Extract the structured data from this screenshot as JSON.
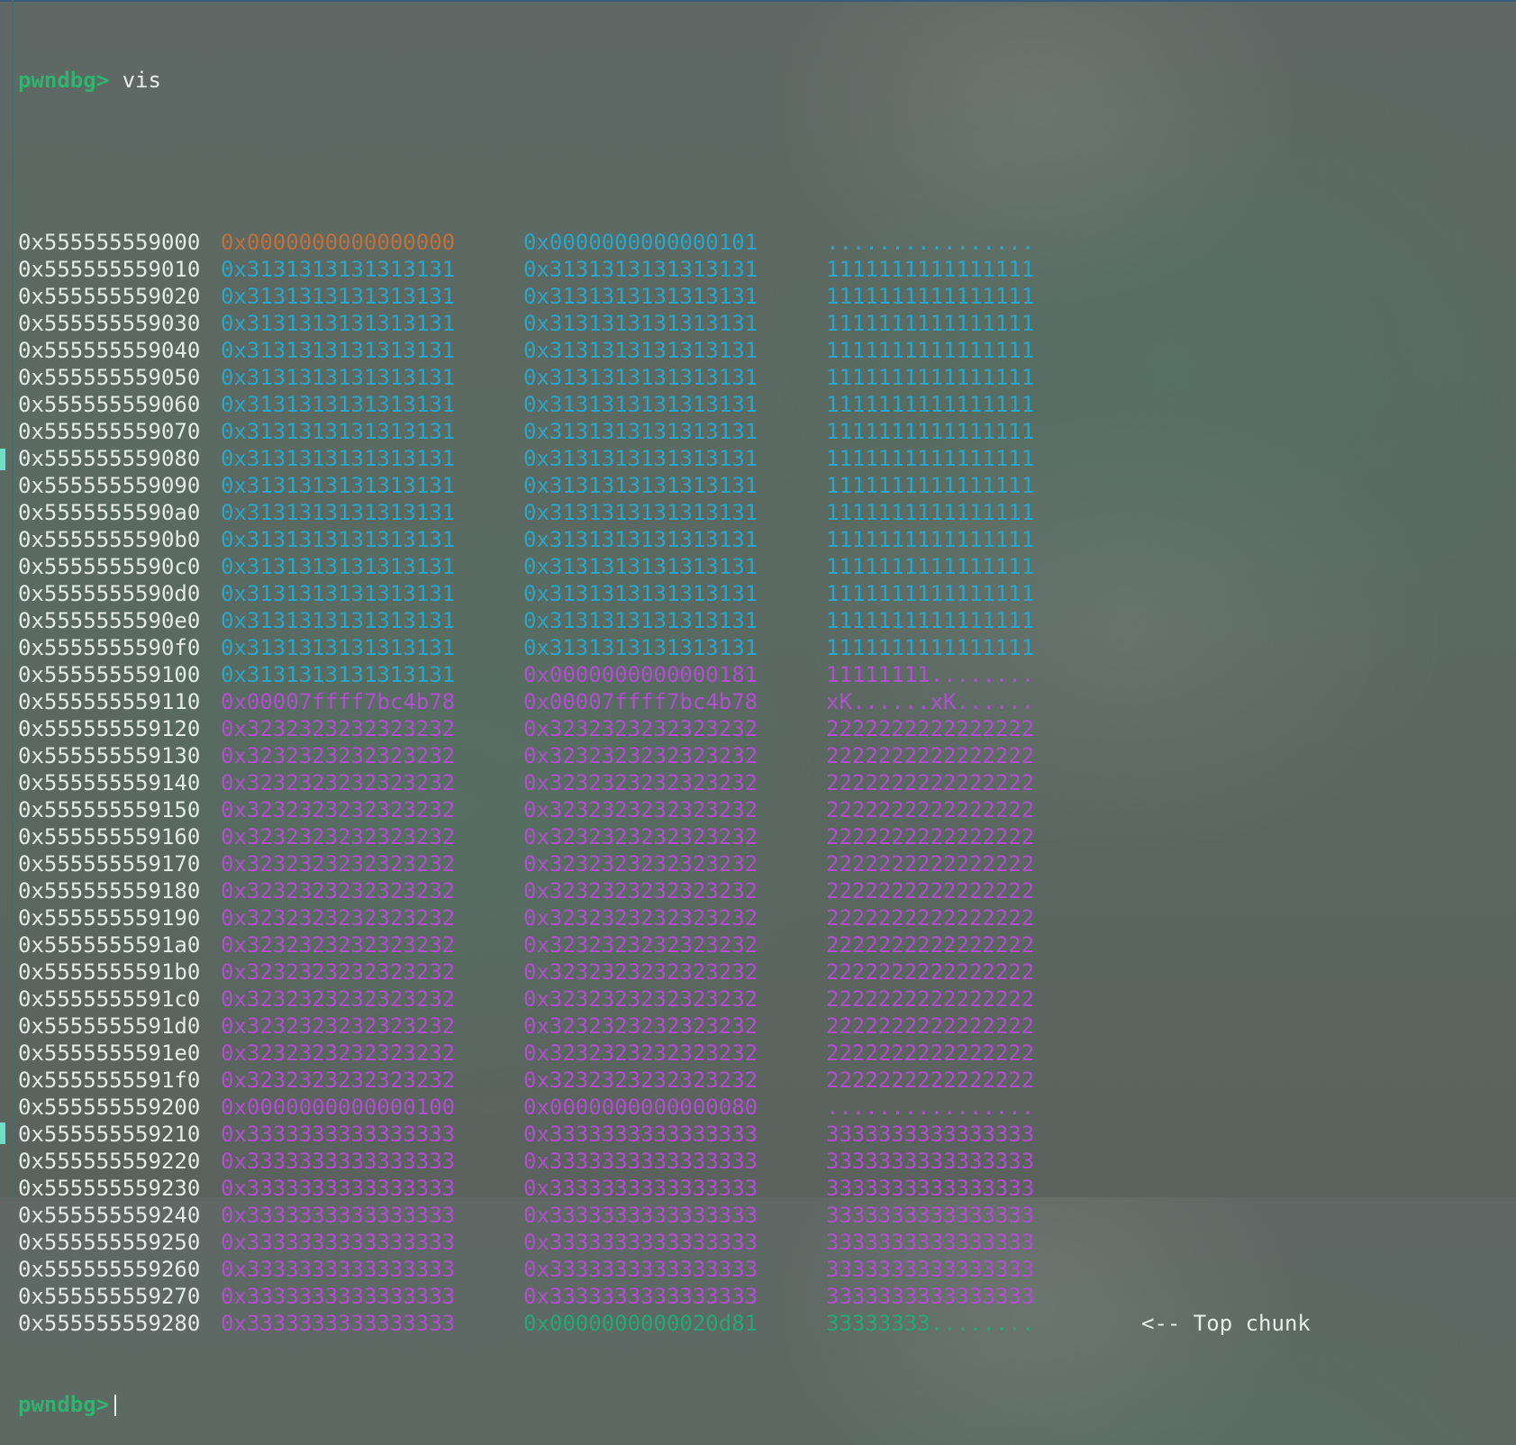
{
  "prompt": "pwndbg>",
  "command": "vis",
  "rows": [
    {
      "addr": "0x555555559000",
      "q1": "0x0000000000000000",
      "q2": "0x0000000000000101",
      "ascii": "................",
      "c1": "orange",
      "c2": "cyan",
      "c3": "cyan"
    },
    {
      "addr": "0x555555559010",
      "q1": "0x3131313131313131",
      "q2": "0x3131313131313131",
      "ascii": "1111111111111111",
      "c1": "cyan",
      "c2": "cyan",
      "c3": "cyan"
    },
    {
      "addr": "0x555555559020",
      "q1": "0x3131313131313131",
      "q2": "0x3131313131313131",
      "ascii": "1111111111111111",
      "c1": "cyan",
      "c2": "cyan",
      "c3": "cyan"
    },
    {
      "addr": "0x555555559030",
      "q1": "0x3131313131313131",
      "q2": "0x3131313131313131",
      "ascii": "1111111111111111",
      "c1": "cyan",
      "c2": "cyan",
      "c3": "cyan"
    },
    {
      "addr": "0x555555559040",
      "q1": "0x3131313131313131",
      "q2": "0x3131313131313131",
      "ascii": "1111111111111111",
      "c1": "cyan",
      "c2": "cyan",
      "c3": "cyan"
    },
    {
      "addr": "0x555555559050",
      "q1": "0x3131313131313131",
      "q2": "0x3131313131313131",
      "ascii": "1111111111111111",
      "c1": "cyan",
      "c2": "cyan",
      "c3": "cyan"
    },
    {
      "addr": "0x555555559060",
      "q1": "0x3131313131313131",
      "q2": "0x3131313131313131",
      "ascii": "1111111111111111",
      "c1": "cyan",
      "c2": "cyan",
      "c3": "cyan"
    },
    {
      "addr": "0x555555559070",
      "q1": "0x3131313131313131",
      "q2": "0x3131313131313131",
      "ascii": "1111111111111111",
      "c1": "cyan",
      "c2": "cyan",
      "c3": "cyan"
    },
    {
      "addr": "0x555555559080",
      "q1": "0x3131313131313131",
      "q2": "0x3131313131313131",
      "ascii": "1111111111111111",
      "c1": "cyan",
      "c2": "cyan",
      "c3": "cyan"
    },
    {
      "addr": "0x555555559090",
      "q1": "0x3131313131313131",
      "q2": "0x3131313131313131",
      "ascii": "1111111111111111",
      "c1": "cyan",
      "c2": "cyan",
      "c3": "cyan"
    },
    {
      "addr": "0x5555555590a0",
      "q1": "0x3131313131313131",
      "q2": "0x3131313131313131",
      "ascii": "1111111111111111",
      "c1": "cyan",
      "c2": "cyan",
      "c3": "cyan"
    },
    {
      "addr": "0x5555555590b0",
      "q1": "0x3131313131313131",
      "q2": "0x3131313131313131",
      "ascii": "1111111111111111",
      "c1": "cyan",
      "c2": "cyan",
      "c3": "cyan"
    },
    {
      "addr": "0x5555555590c0",
      "q1": "0x3131313131313131",
      "q2": "0x3131313131313131",
      "ascii": "1111111111111111",
      "c1": "cyan",
      "c2": "cyan",
      "c3": "cyan"
    },
    {
      "addr": "0x5555555590d0",
      "q1": "0x3131313131313131",
      "q2": "0x3131313131313131",
      "ascii": "1111111111111111",
      "c1": "cyan",
      "c2": "cyan",
      "c3": "cyan"
    },
    {
      "addr": "0x5555555590e0",
      "q1": "0x3131313131313131",
      "q2": "0x3131313131313131",
      "ascii": "1111111111111111",
      "c1": "cyan",
      "c2": "cyan",
      "c3": "cyan"
    },
    {
      "addr": "0x5555555590f0",
      "q1": "0x3131313131313131",
      "q2": "0x3131313131313131",
      "ascii": "1111111111111111",
      "c1": "cyan",
      "c2": "cyan",
      "c3": "cyan"
    },
    {
      "addr": "0x555555559100",
      "q1": "0x3131313131313131",
      "q2": "0x0000000000000181",
      "ascii": "11111111........",
      "c1": "cyan",
      "c2": "magenta",
      "c3": "magenta"
    },
    {
      "addr": "0x555555559110",
      "q1": "0x00007ffff7bc4b78",
      "q2": "0x00007ffff7bc4b78",
      "ascii": "xK......xK......",
      "c1": "magenta",
      "c2": "magenta",
      "c3": "magenta"
    },
    {
      "addr": "0x555555559120",
      "q1": "0x3232323232323232",
      "q2": "0x3232323232323232",
      "ascii": "2222222222222222",
      "c1": "magenta",
      "c2": "magenta",
      "c3": "magenta"
    },
    {
      "addr": "0x555555559130",
      "q1": "0x3232323232323232",
      "q2": "0x3232323232323232",
      "ascii": "2222222222222222",
      "c1": "magenta",
      "c2": "magenta",
      "c3": "magenta"
    },
    {
      "addr": "0x555555559140",
      "q1": "0x3232323232323232",
      "q2": "0x3232323232323232",
      "ascii": "2222222222222222",
      "c1": "magenta",
      "c2": "magenta",
      "c3": "magenta"
    },
    {
      "addr": "0x555555559150",
      "q1": "0x3232323232323232",
      "q2": "0x3232323232323232",
      "ascii": "2222222222222222",
      "c1": "magenta",
      "c2": "magenta",
      "c3": "magenta"
    },
    {
      "addr": "0x555555559160",
      "q1": "0x3232323232323232",
      "q2": "0x3232323232323232",
      "ascii": "2222222222222222",
      "c1": "magenta",
      "c2": "magenta",
      "c3": "magenta"
    },
    {
      "addr": "0x555555559170",
      "q1": "0x3232323232323232",
      "q2": "0x3232323232323232",
      "ascii": "2222222222222222",
      "c1": "magenta",
      "c2": "magenta",
      "c3": "magenta"
    },
    {
      "addr": "0x555555559180",
      "q1": "0x3232323232323232",
      "q2": "0x3232323232323232",
      "ascii": "2222222222222222",
      "c1": "magenta",
      "c2": "magenta",
      "c3": "magenta"
    },
    {
      "addr": "0x555555559190",
      "q1": "0x3232323232323232",
      "q2": "0x3232323232323232",
      "ascii": "2222222222222222",
      "c1": "magenta",
      "c2": "magenta",
      "c3": "magenta"
    },
    {
      "addr": "0x5555555591a0",
      "q1": "0x3232323232323232",
      "q2": "0x3232323232323232",
      "ascii": "2222222222222222",
      "c1": "magenta",
      "c2": "magenta",
      "c3": "magenta"
    },
    {
      "addr": "0x5555555591b0",
      "q1": "0x3232323232323232",
      "q2": "0x3232323232323232",
      "ascii": "2222222222222222",
      "c1": "magenta",
      "c2": "magenta",
      "c3": "magenta"
    },
    {
      "addr": "0x5555555591c0",
      "q1": "0x3232323232323232",
      "q2": "0x3232323232323232",
      "ascii": "2222222222222222",
      "c1": "magenta",
      "c2": "magenta",
      "c3": "magenta"
    },
    {
      "addr": "0x5555555591d0",
      "q1": "0x3232323232323232",
      "q2": "0x3232323232323232",
      "ascii": "2222222222222222",
      "c1": "magenta",
      "c2": "magenta",
      "c3": "magenta"
    },
    {
      "addr": "0x5555555591e0",
      "q1": "0x3232323232323232",
      "q2": "0x3232323232323232",
      "ascii": "2222222222222222",
      "c1": "magenta",
      "c2": "magenta",
      "c3": "magenta"
    },
    {
      "addr": "0x5555555591f0",
      "q1": "0x3232323232323232",
      "q2": "0x3232323232323232",
      "ascii": "2222222222222222",
      "c1": "magenta",
      "c2": "magenta",
      "c3": "magenta"
    },
    {
      "addr": "0x555555559200",
      "q1": "0x0000000000000100",
      "q2": "0x0000000000000080",
      "ascii": "................",
      "c1": "magenta",
      "c2": "magenta",
      "c3": "magenta"
    },
    {
      "addr": "0x555555559210",
      "q1": "0x3333333333333333",
      "q2": "0x3333333333333333",
      "ascii": "3333333333333333",
      "c1": "magenta",
      "c2": "magenta",
      "c3": "magenta"
    },
    {
      "addr": "0x555555559220",
      "q1": "0x3333333333333333",
      "q2": "0x3333333333333333",
      "ascii": "3333333333333333",
      "c1": "magenta",
      "c2": "magenta",
      "c3": "magenta"
    },
    {
      "addr": "0x555555559230",
      "q1": "0x3333333333333333",
      "q2": "0x3333333333333333",
      "ascii": "3333333333333333",
      "c1": "magenta",
      "c2": "magenta",
      "c3": "magenta"
    },
    {
      "addr": "0x555555559240",
      "q1": "0x3333333333333333",
      "q2": "0x3333333333333333",
      "ascii": "3333333333333333",
      "c1": "magenta",
      "c2": "magenta",
      "c3": "magenta"
    },
    {
      "addr": "0x555555559250",
      "q1": "0x3333333333333333",
      "q2": "0x3333333333333333",
      "ascii": "3333333333333333",
      "c1": "magenta",
      "c2": "magenta",
      "c3": "magenta"
    },
    {
      "addr": "0x555555559260",
      "q1": "0x3333333333333333",
      "q2": "0x3333333333333333",
      "ascii": "3333333333333333",
      "c1": "magenta",
      "c2": "magenta",
      "c3": "magenta"
    },
    {
      "addr": "0x555555559270",
      "q1": "0x3333333333333333",
      "q2": "0x3333333333333333",
      "ascii": "3333333333333333",
      "c1": "magenta",
      "c2": "magenta",
      "c3": "magenta"
    },
    {
      "addr": "0x555555559280",
      "q1": "0x3333333333333333",
      "q2": "0x0000000000020d81",
      "ascii": "33333333........",
      "c1": "magenta",
      "c2": "green",
      "c3": "green",
      "note": "<-- Top chunk"
    }
  ],
  "colors": {
    "orange": "#c0703a",
    "cyan": "#2aa6c8",
    "magenta": "#b24fd0",
    "green": "#23a87a",
    "prompt": "#2fb36f"
  }
}
